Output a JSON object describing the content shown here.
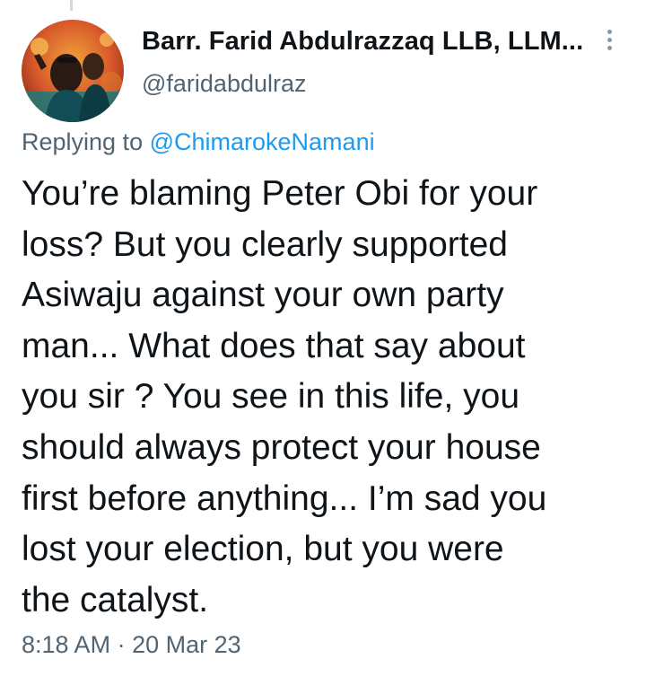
{
  "tweet": {
    "author": {
      "display_name": "Barr. Farid Abdulrazzaq LLB, LLM...",
      "handle": "@faridabdulraz"
    },
    "reply_prefix": "Replying to ",
    "reply_to": "@ChimarokeNamani",
    "body_lines": [
      "You’re blaming Peter Obi for your",
      "loss? But you clearly supported",
      "Asiwaju against your own party",
      "man... What does that say about",
      "you sir ? You see in this life, you",
      "should always protect your house",
      "first before anything... I’m sad you",
      "lost your election, but you were",
      "the catalyst."
    ],
    "time": "8:18 AM",
    "separator": " · ",
    "date": "20 Mar 23",
    "more_icon": "vertical-dots-icon"
  },
  "colors": {
    "text": "#0f1419",
    "secondary": "#536471",
    "link": "#1d9bf0",
    "background": "#ffffff"
  }
}
